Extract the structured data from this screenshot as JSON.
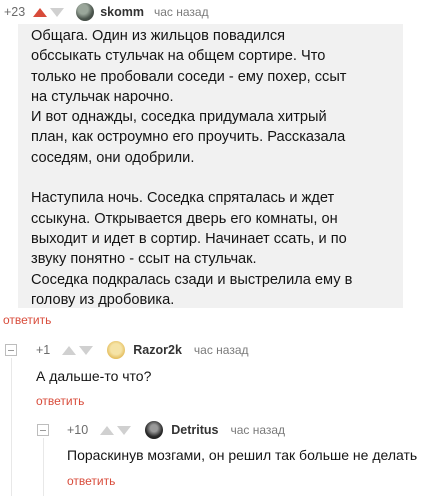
{
  "comment1": {
    "rating": "+23",
    "author": "skomm",
    "time": "час назад",
    "text": "Общага. Один из жильцов повадился\nобссыкать стульчак на общем сортире. Что\nтолько не пробовали соседи - ему похер, ссыт\nна стульчак нарочно.\nИ вот однажды, соседка придумала хитрый\nплан, как остроумно его проучить. Рассказала\nсоседям, они одобрили.\n\nНаступила ночь. Соседка спряталась и ждет\nссыкуна. Открывается дверь его комнаты, он\nвыходит и идет в сортир. Начинает ссать, и по\nзвуку понятно - ссыт на стульчак.\nСоседка подкралась сзади и выстрелила ему в\nголову из дробовика.",
    "reply_label": "ответить"
  },
  "comment2": {
    "rating": "+1",
    "author": "Razor2k",
    "time": "час назад",
    "text": "А дальше-то что?",
    "reply_label": "ответить"
  },
  "comment3": {
    "rating": "+10",
    "author": "Detritus",
    "time": "час назад",
    "text": "Пораскинув мозгами, он решил так больше не делать",
    "reply_label": "ответить"
  },
  "colors": {
    "accent": "#d84b3a",
    "vote_inactive": "#d0d0d0",
    "body_bg": "#f1f1f1"
  }
}
